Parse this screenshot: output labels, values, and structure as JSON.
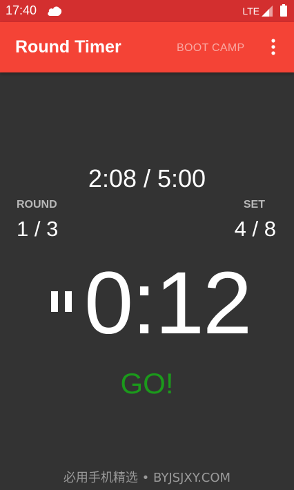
{
  "status_bar": {
    "time": "17:40",
    "network": "LTE",
    "icons": [
      "cloud-icon",
      "signal-icon",
      "battery-icon"
    ],
    "background_color": "#d32f2f"
  },
  "app_bar": {
    "title": "Round Timer",
    "action_label": "BOOT CAMP",
    "overflow_icon": "more-vert-icon",
    "background_color": "#f44336"
  },
  "timer": {
    "total_elapsed": "2:08 / 5:00",
    "round_label": "ROUND",
    "round_value": "1 / 3",
    "set_label": "SET",
    "set_value": "4 / 8",
    "countdown": "0:12",
    "state_icon": "pause-icon",
    "status_text": "GO!",
    "status_color": "#1b9a1b"
  },
  "watermark": {
    "text": "必用手机精选 • BYJSJXY.COM"
  }
}
